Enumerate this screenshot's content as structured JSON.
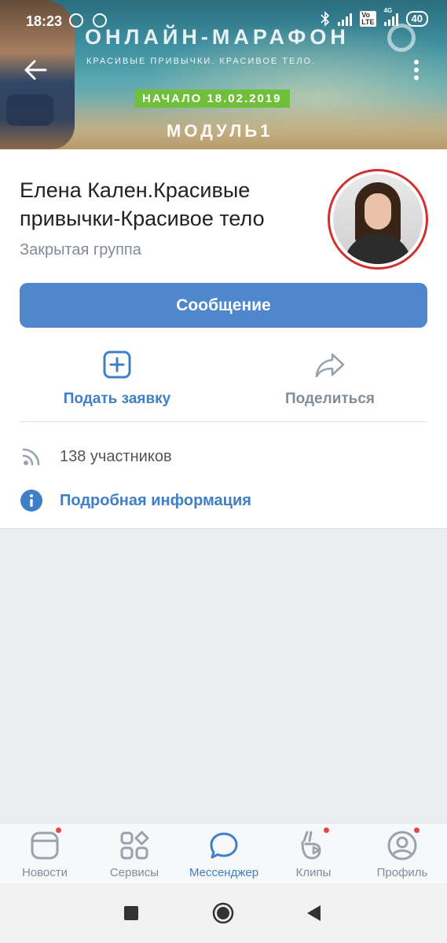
{
  "status_bar": {
    "time": "18:23",
    "network": "4G",
    "battery": "40"
  },
  "cover": {
    "title": "ОНЛАЙН-МАРАФОН",
    "subtitle": "КРАСИВЫЕ ПРИВЫЧКИ. КРАСИВОЕ ТЕЛО.",
    "badge": "НАЧАЛО 18.02.2019",
    "module": "МОДУЛЬ1"
  },
  "group": {
    "name_line1": "Елена Кален.Красивые",
    "name_line2": "привычки-Красивое тело",
    "type": "Закрытая группа"
  },
  "actions": {
    "message": "Сообщение",
    "join": "Подать заявку",
    "share": "Поделиться"
  },
  "info": {
    "members": "138 участников",
    "details": "Подробная информация"
  },
  "tabs": [
    {
      "label": "Новости",
      "icon": "news-icon",
      "badge": true
    },
    {
      "label": "Сервисы",
      "icon": "services-icon",
      "badge": false
    },
    {
      "label": "Мессенджер",
      "icon": "messenger-icon",
      "badge": false,
      "active": true
    },
    {
      "label": "Клипы",
      "icon": "clips-icon",
      "badge": true
    },
    {
      "label": "Профиль",
      "icon": "profile-icon",
      "badge": true
    }
  ],
  "colors": {
    "accent": "#4f87cd",
    "link": "#3f7fc8",
    "muted": "#818c99",
    "badge": "#e64646",
    "avatar_ring": "#d32f2f"
  }
}
